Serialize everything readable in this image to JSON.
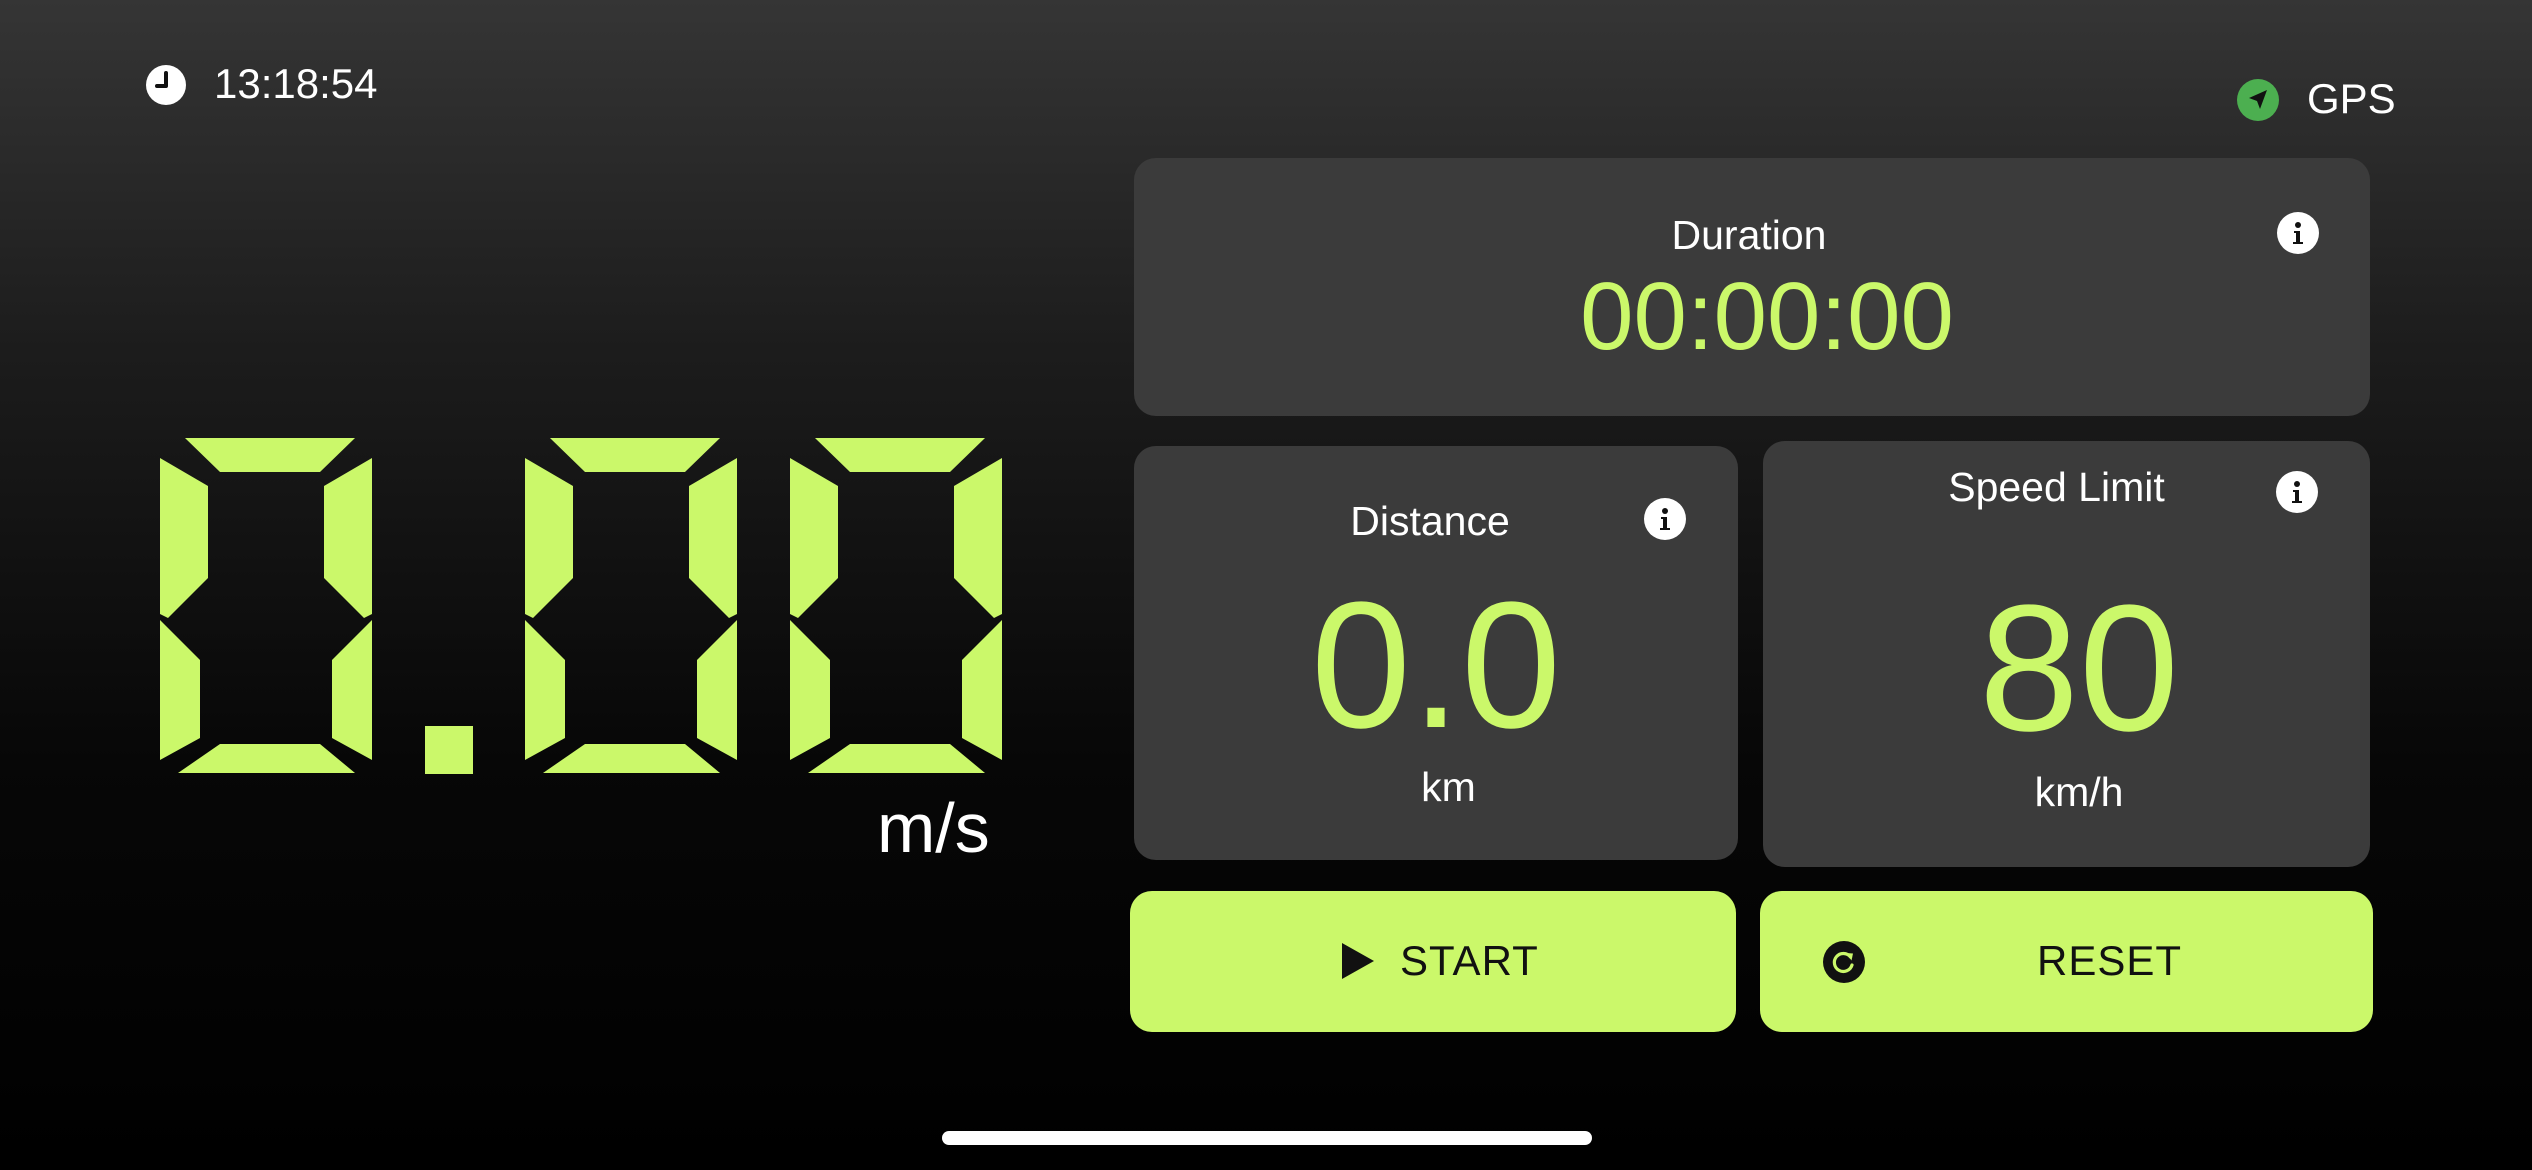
{
  "status": {
    "time": "13:18:54",
    "gps_label": "GPS",
    "gps_color": "#4caf50"
  },
  "speed": {
    "value": "0.00",
    "unit": "m/s"
  },
  "duration": {
    "label": "Duration",
    "value": "00:00:00"
  },
  "distance": {
    "label": "Distance",
    "value": "0.0",
    "unit": "km"
  },
  "speed_limit": {
    "label": "Speed Limit",
    "value": "80",
    "unit": "km/h"
  },
  "buttons": {
    "start_label": "START",
    "reset_label": "RESET"
  },
  "colors": {
    "accent": "#cbf86a",
    "panel": "#3b3b3b",
    "background": "#000000"
  },
  "icons": [
    "clock-icon",
    "gps-arrow-icon",
    "info-icon",
    "play-icon",
    "reset-icon"
  ]
}
